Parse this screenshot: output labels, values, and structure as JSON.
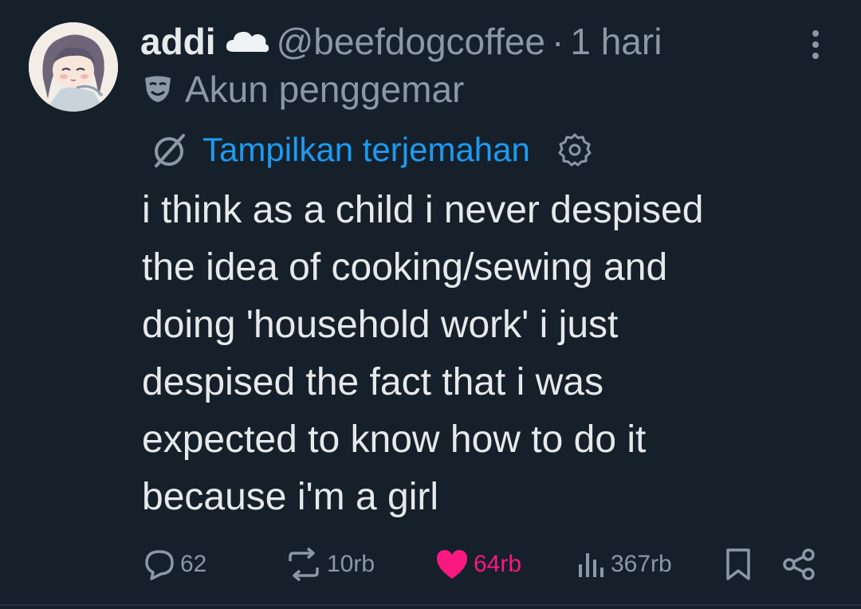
{
  "tweet": {
    "display_name": "addi",
    "handle": "@beefdogcoffee",
    "separator": "·",
    "time": "1 hari",
    "account_label": "Akun penggemar",
    "translate_label": "Tampilkan terjemahan",
    "text_lines": [
      "i think as a child i never despised",
      "the idea of cooking/sewing and",
      "doing 'household work' i just",
      "despised the fact that i was",
      "expected to know how to do it",
      "because i'm a girl"
    ]
  },
  "actions": {
    "replies": "62",
    "reposts": "10rb",
    "likes": "64rb",
    "views": "367rb"
  },
  "icons": {
    "name_badge": "cloud-icon",
    "account_label": "theater-mask-icon",
    "translate": "translate-icon",
    "translate_settings": "gear-icon",
    "more": "more-vertical-icon",
    "reply": "speech-bubble-icon",
    "repost": "repost-icon",
    "like": "heart-icon",
    "views": "bar-chart-icon",
    "bookmark": "bookmark-icon",
    "share": "share-icon"
  },
  "colors": {
    "background": "#15202b",
    "text_primary": "#e7e9ea",
    "text_secondary": "#8b98a5",
    "link": "#1d9bf0",
    "like": "#f91880"
  }
}
